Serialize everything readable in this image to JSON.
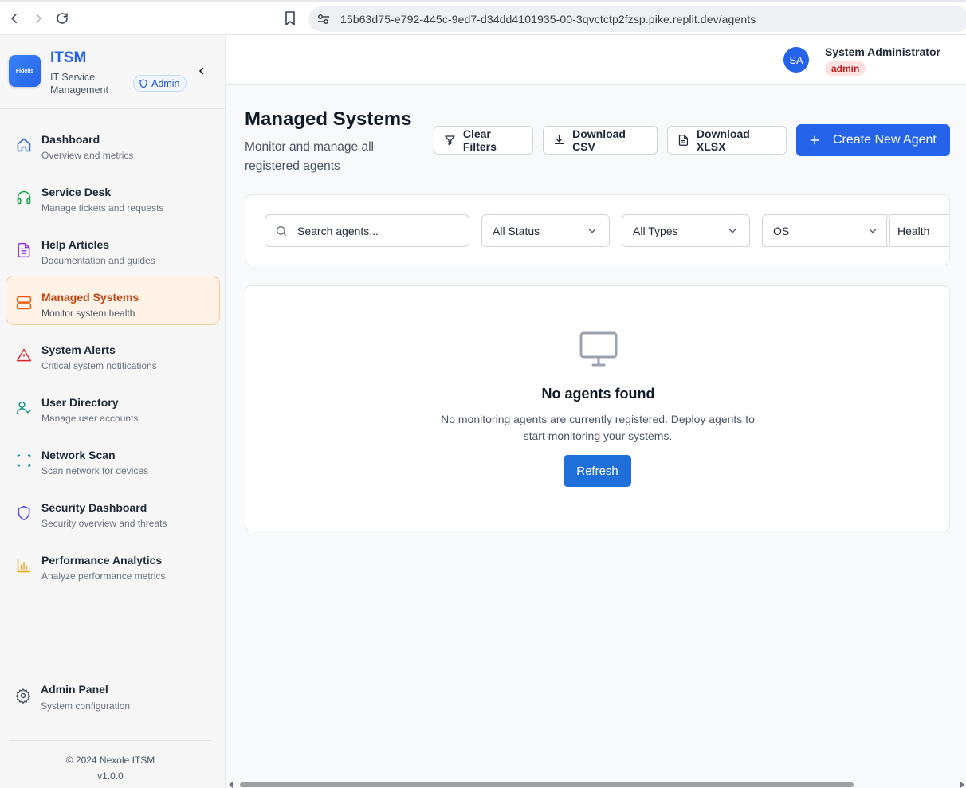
{
  "browser": {
    "url": "15b63d75-e792-445c-9ed7-d34dd4101935-00-3qvctctp2fzsp.pike.replit.dev/agents"
  },
  "brand": {
    "logo_text": "Fidelis",
    "title": "ITSM",
    "subtitle": "IT Service Management",
    "badge": "Admin",
    "accent_color": "#2563eb"
  },
  "sidebar": {
    "items": [
      {
        "label": "Dashboard",
        "desc": "Overview and metrics",
        "icon": "home-icon",
        "color": "#2563eb"
      },
      {
        "label": "Service Desk",
        "desc": "Manage tickets and requests",
        "icon": "headphones-icon",
        "color": "#16a34a"
      },
      {
        "label": "Help Articles",
        "desc": "Documentation and guides",
        "icon": "file-text-icon",
        "color": "#9333ea"
      },
      {
        "label": "Managed Systems",
        "desc": "Monitor system health",
        "icon": "server-icon",
        "color": "#ea580c",
        "active": true
      },
      {
        "label": "System Alerts",
        "desc": "Critical system notifications",
        "icon": "alert-triangle-icon",
        "color": "#dc2626"
      },
      {
        "label": "User Directory",
        "desc": "Manage user accounts",
        "icon": "user-check-icon",
        "color": "#0d9488"
      },
      {
        "label": "Network Scan",
        "desc": "Scan network for devices",
        "icon": "scan-icon",
        "color": "#0891b2"
      },
      {
        "label": "Security Dashboard",
        "desc": "Security overview and threats",
        "icon": "shield-icon",
        "color": "#4f46e5"
      },
      {
        "label": "Performance Analytics",
        "desc": "Analyze performance metrics",
        "icon": "bar-chart-icon",
        "color": "#f59e0b"
      }
    ],
    "admin_panel": {
      "label": "Admin Panel",
      "desc": "System configuration",
      "icon": "gear-icon"
    },
    "footer": {
      "copyright": "© 2024 Nexole ITSM",
      "version": "v1.0.0"
    }
  },
  "header": {
    "avatar_initials": "SA",
    "user_name": "System Administrator",
    "user_role": "admin"
  },
  "main": {
    "title": "Managed Systems",
    "subtitle": "Monitor and manage all registered agents",
    "buttons": {
      "clear_filters": "Clear Filters",
      "download_csv": "Download CSV",
      "download_xlsx": "Download XLSX",
      "create_agent": "Create New Agent"
    },
    "filters": {
      "search_placeholder": "Search agents...",
      "status": "All Status",
      "types": "All Types",
      "os": "OS",
      "health": "Health"
    },
    "empty": {
      "title": "No agents found",
      "description": "No monitoring agents are currently registered. Deploy agents to start monitoring your systems.",
      "refresh": "Refresh"
    }
  }
}
